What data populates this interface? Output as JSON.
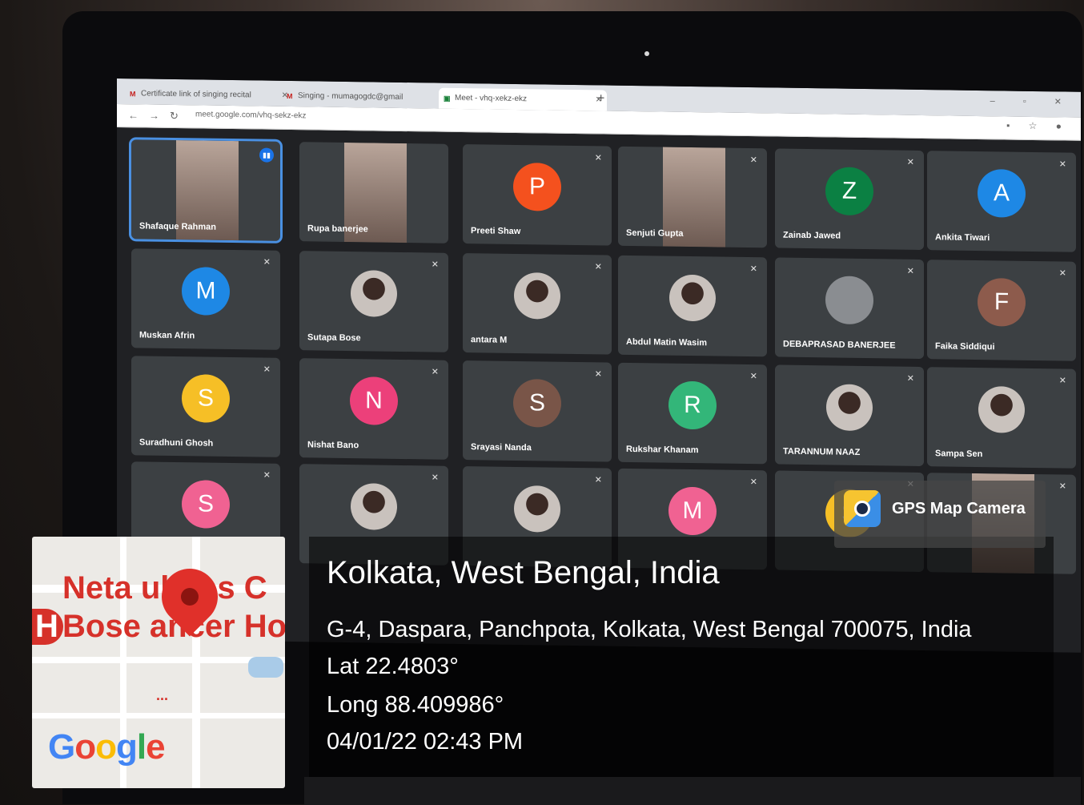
{
  "browser": {
    "tabs": [
      {
        "label": "Certificate link of singing recital",
        "icon": "gmail-icon"
      },
      {
        "label": "Singing - mumagogdc@gmail",
        "icon": "gmail-icon"
      },
      {
        "label": "Meet - vhq-xekz-ekz",
        "icon": "meet-icon"
      }
    ],
    "url": "meet.google.com/vhq-sekz-ekz"
  },
  "participants": [
    {
      "name": "Shafaque Rahman",
      "kind": "video",
      "speaking": true
    },
    {
      "name": "Rupa banerjee",
      "kind": "video"
    },
    {
      "name": "Preeti Shaw",
      "initial": "P",
      "color": "#f4511e"
    },
    {
      "name": "Senjuti Gupta",
      "kind": "video"
    },
    {
      "name": "Zainab Jawed",
      "initial": "Z",
      "color": "#0b8043"
    },
    {
      "name": "Ankita Tiwari",
      "initial": "A",
      "color": "#1e88e5"
    },
    {
      "name": "Muskan Afrin",
      "initial": "M",
      "color": "#1e88e5"
    },
    {
      "name": "Sutapa Bose",
      "kind": "photo"
    },
    {
      "name": "antara M",
      "kind": "photo"
    },
    {
      "name": "Abdul Matin Wasim",
      "kind": "photo"
    },
    {
      "name": "DEBAPRASAD BANERJEE",
      "initial": "",
      "color": "#8a8d91"
    },
    {
      "name": "Faika Siddiqui",
      "initial": "F",
      "color": "#8d5b4c"
    },
    {
      "name": "Suradhuni Ghosh",
      "initial": "S",
      "color": "#f6bf26"
    },
    {
      "name": "Nishat Bano",
      "initial": "N",
      "color": "#ec407a"
    },
    {
      "name": "Srayasi Nanda",
      "initial": "S",
      "color": "#795548"
    },
    {
      "name": "Rukshar Khanam",
      "initial": "R",
      "color": "#33b679"
    },
    {
      "name": "TARANNUM NAAZ",
      "kind": "photo"
    },
    {
      "name": "Sampa Sen",
      "kind": "photo"
    },
    {
      "name": "",
      "initial": "S",
      "color": "#f06292"
    },
    {
      "name": "",
      "kind": "photo"
    },
    {
      "name": "",
      "kind": "photo"
    },
    {
      "name": "",
      "initial": "M",
      "color": "#f06292"
    },
    {
      "name": "",
      "initial": "S",
      "color": "#f6bf26"
    },
    {
      "name": "",
      "kind": "video"
    }
  ],
  "map": {
    "text_line1": "Neta ubhas C",
    "text_line2": "Bose ancer Ho",
    "edge_letter": "H",
    "dots": "...",
    "logo": "Google"
  },
  "geotag": {
    "app_name": "GPS Map Camera",
    "city": "Kolkata, West Bengal, India",
    "address": "G-4, Daspara, Panchpota, Kolkata, West Bengal 700075, India",
    "lat": "Lat 22.4803°",
    "long": "Long 88.409986°",
    "datetime": "04/01/22 02:43 PM"
  }
}
